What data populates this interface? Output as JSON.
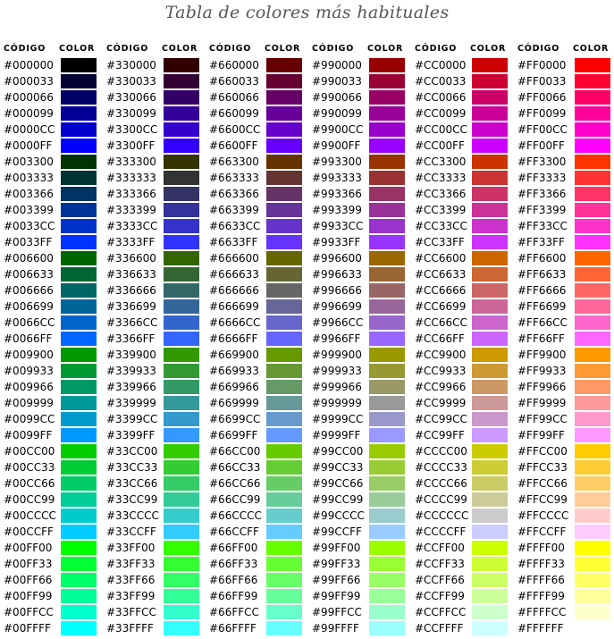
{
  "title": "Tabla de colores más habituales",
  "headers": {
    "code": "CÓDIGO",
    "color": "COLOR"
  },
  "groups": [
    {
      "prefix": "00"
    },
    {
      "prefix": "33"
    },
    {
      "prefix": "66"
    },
    {
      "prefix": "99"
    },
    {
      "prefix": "CC"
    },
    {
      "prefix": "FF"
    }
  ],
  "channel_values": [
    "00",
    "33",
    "66",
    "99",
    "CC",
    "FF"
  ],
  "colors": [
    [
      "#000000",
      "#000033",
      "#000066",
      "#000099",
      "#0000CC",
      "#0000FF",
      "#003300",
      "#003333",
      "#003366",
      "#003399",
      "#0033CC",
      "#0033FF",
      "#006600",
      "#006633",
      "#006666",
      "#006699",
      "#0066CC",
      "#0066FF",
      "#009900",
      "#009933",
      "#009966",
      "#009999",
      "#0099CC",
      "#0099FF",
      "#00CC00",
      "#00CC33",
      "#00CC66",
      "#00CC99",
      "#00CCCC",
      "#00CCFF",
      "#00FF00",
      "#00FF33",
      "#00FF66",
      "#00FF99",
      "#00FFCC",
      "#00FFFF"
    ],
    [
      "#330000",
      "#330033",
      "#330066",
      "#330099",
      "#3300CC",
      "#3300FF",
      "#333300",
      "#333333",
      "#333366",
      "#333399",
      "#3333CC",
      "#3333FF",
      "#336600",
      "#336633",
      "#336666",
      "#336699",
      "#3366CC",
      "#3366FF",
      "#339900",
      "#339933",
      "#339966",
      "#339999",
      "#3399CC",
      "#3399FF",
      "#33CC00",
      "#33CC33",
      "#33CC66",
      "#33CC99",
      "#33CCCC",
      "#33CCFF",
      "#33FF00",
      "#33FF33",
      "#33FF66",
      "#33FF99",
      "#33FFCC",
      "#33FFFF"
    ],
    [
      "#660000",
      "#660033",
      "#660066",
      "#660099",
      "#6600CC",
      "#6600FF",
      "#663300",
      "#663333",
      "#663366",
      "#663399",
      "#6633CC",
      "#6633FF",
      "#666600",
      "#666633",
      "#666666",
      "#666699",
      "#6666CC",
      "#6666FF",
      "#669900",
      "#669933",
      "#669966",
      "#669999",
      "#6699CC",
      "#6699FF",
      "#66CC00",
      "#66CC33",
      "#66CC66",
      "#66CC99",
      "#66CCCC",
      "#66CCFF",
      "#66FF00",
      "#66FF33",
      "#66FF66",
      "#66FF99",
      "#66FFCC",
      "#66FFFF"
    ],
    [
      "#990000",
      "#990033",
      "#990066",
      "#990099",
      "#9900CC",
      "#9900FF",
      "#993300",
      "#993333",
      "#993366",
      "#993399",
      "#9933CC",
      "#9933FF",
      "#996600",
      "#996633",
      "#996666",
      "#996699",
      "#9966CC",
      "#9966FF",
      "#999900",
      "#999933",
      "#999966",
      "#999999",
      "#9999CC",
      "#9999FF",
      "#99CC00",
      "#99CC33",
      "#99CC66",
      "#99CC99",
      "#99CCCC",
      "#99CCFF",
      "#99FF00",
      "#99FF33",
      "#99FF66",
      "#99FF99",
      "#99FFCC",
      "#99FFFF"
    ],
    [
      "#CC0000",
      "#CC0033",
      "#CC0066",
      "#CC0099",
      "#CC00CC",
      "#CC00FF",
      "#CC3300",
      "#CC3333",
      "#CC3366",
      "#CC3399",
      "#CC33CC",
      "#CC33FF",
      "#CC6600",
      "#CC6633",
      "#CC6666",
      "#CC6699",
      "#CC66CC",
      "#CC66FF",
      "#CC9900",
      "#CC9933",
      "#CC9966",
      "#CC9999",
      "#CC99CC",
      "#CC99FF",
      "#CCCC00",
      "#CCCC33",
      "#CCCC66",
      "#CCCC99",
      "#CCCCCC",
      "#CCCCFF",
      "#CCFF00",
      "#CCFF33",
      "#CCFF66",
      "#CCFF99",
      "#CCFFCC",
      "#CCFFFF"
    ],
    [
      "#FF0000",
      "#FF0033",
      "#FF0066",
      "#FF0099",
      "#FF00CC",
      "#FF00FF",
      "#FF3300",
      "#FF3333",
      "#FF3366",
      "#FF3399",
      "#FF33CC",
      "#FF33FF",
      "#FF6600",
      "#FF6633",
      "#FF6666",
      "#FF6699",
      "#FF66CC",
      "#FF66FF",
      "#FF9900",
      "#FF9933",
      "#FF9966",
      "#FF9999",
      "#FF99CC",
      "#FF99FF",
      "#FFCC00",
      "#FFCC33",
      "#FFCC66",
      "#FFCC99",
      "#FFCCCC",
      "#FFCCFF",
      "#FFFF00",
      "#FFFF33",
      "#FFFF66",
      "#FFFF99",
      "#FFFFCC",
      "#FFFFFF"
    ]
  ]
}
